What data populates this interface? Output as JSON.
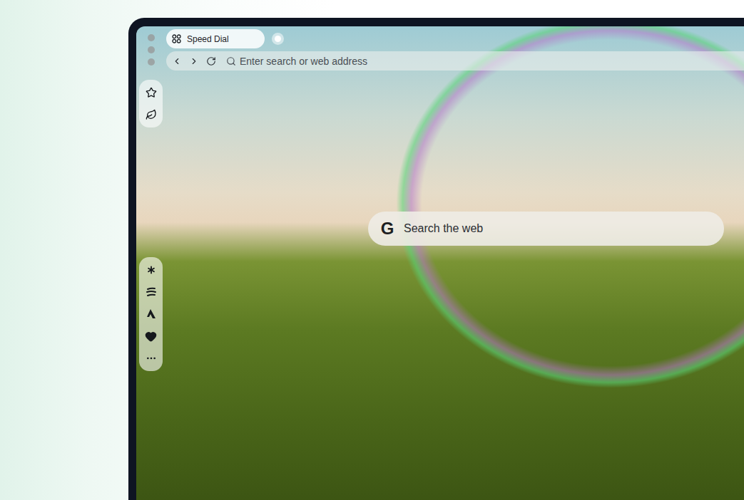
{
  "tabs": [
    {
      "label": "Speed Dial",
      "selected": true
    }
  ],
  "address_bar": {
    "placeholder": "Enter search or web address"
  },
  "search": {
    "engine_logo": "G",
    "placeholder": "Search the web"
  }
}
